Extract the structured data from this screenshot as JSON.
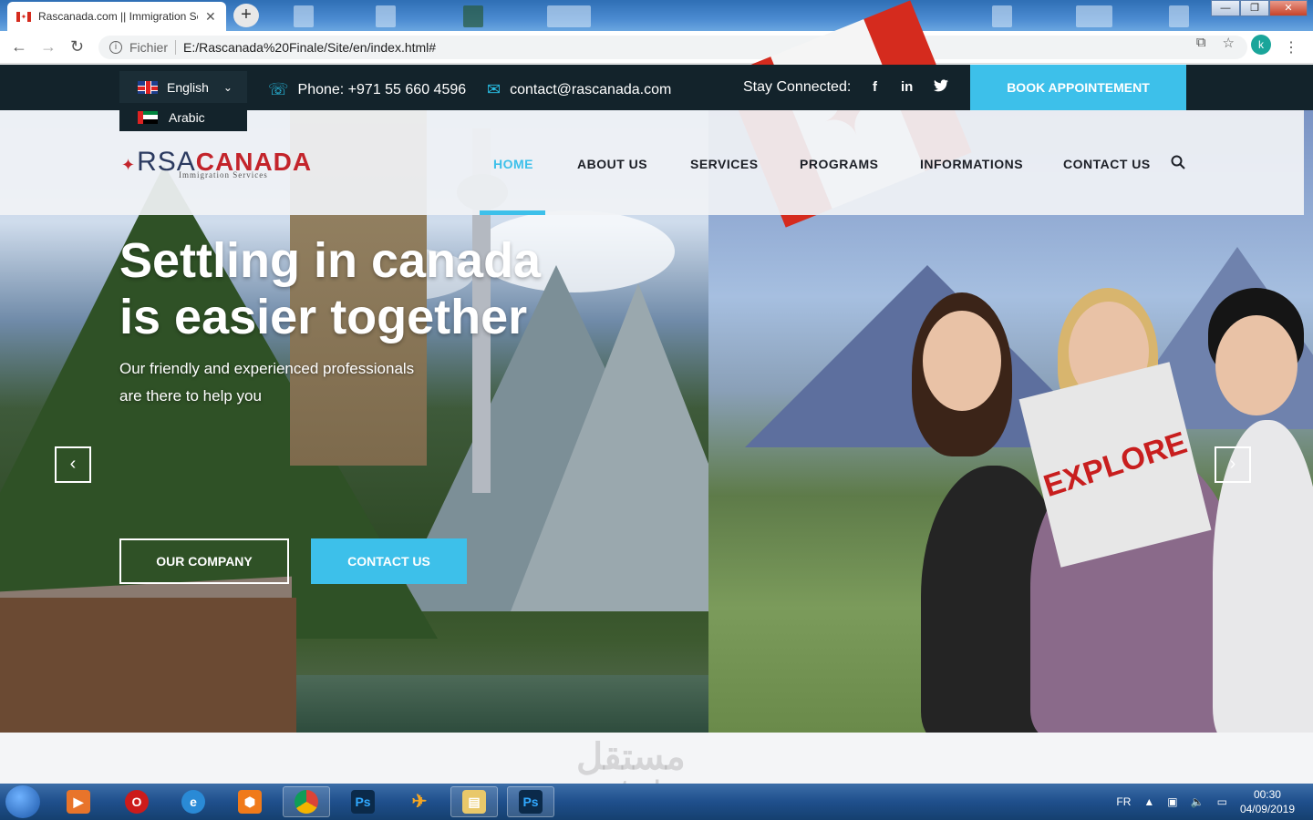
{
  "browser": {
    "tab_title": "Rascanada.com || Immigration Se",
    "tab_close": "✕",
    "new_tab": "+",
    "url_scheme": "Fichier",
    "url": "E:/Rascanada%20Finale/Site/en/index.html#",
    "profile_initial": "k",
    "window_controls": {
      "minimize": "—",
      "maximize": "❐",
      "close": "✕"
    }
  },
  "topbar": {
    "language_selected": "English",
    "language_option": "Arabic",
    "phone": "Phone: +971 55 660 4596",
    "email": "contact@rascanada.com",
    "stay_connected": "Stay Connected:",
    "social": {
      "facebook": "f",
      "linkedin": "in",
      "twitter": "🐦"
    },
    "book_button": "BOOK APPOINTEMENT"
  },
  "logo": {
    "rsa": "RSA",
    "canada": "CANADA",
    "tagline": "Immigration Services"
  },
  "nav": {
    "home": "HOME",
    "about": "ABOUT US",
    "services": "SERVICES",
    "programs": "PROGRAMS",
    "informations": "INFORMATIONS",
    "contact": "CONTACT US"
  },
  "hero": {
    "title_line1": "Settling in canada",
    "title_line2": "is easier together",
    "subtitle_line1": "Our friendly and experienced professionals",
    "subtitle_line2": "are there to help you",
    "btn_company": "OUR COMPANY",
    "btn_contact": "CONTACT US",
    "prev": "‹",
    "next": "›",
    "folder_text": "EXPLORE"
  },
  "watermark": {
    "arabic": "مستقل",
    "latin": "mostaql.com"
  },
  "taskbar": {
    "language": "FR",
    "time": "00:30",
    "date": "04/09/2019",
    "apps": [
      "Media",
      "Opera",
      "IE",
      "Files",
      "Chrome",
      "Ps",
      "Flash",
      "Explorer",
      "Ps"
    ]
  },
  "colors": {
    "accent": "#3dc0ea",
    "dark": "#13232b",
    "brand_red": "#c3242b"
  }
}
